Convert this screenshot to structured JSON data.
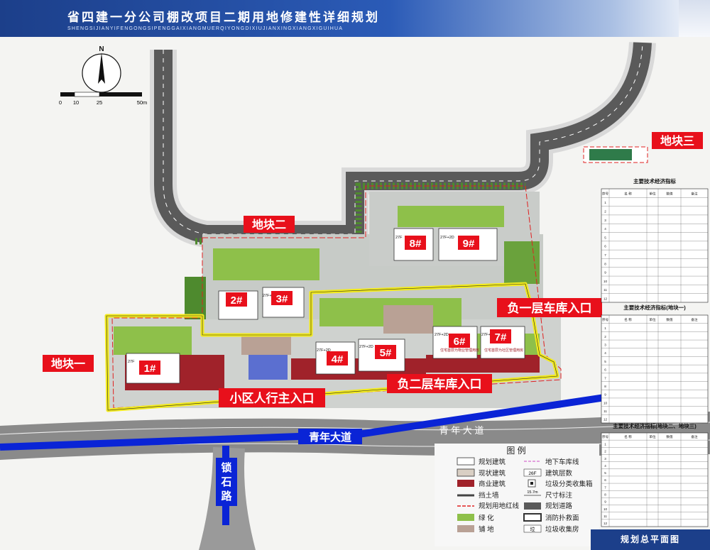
{
  "header": {
    "title": "省四建一分公司棚改项目二期用地修建性详细规划",
    "pinyin": "SHENGSIJIANYIFENGONGSIPENGGAIXIANGMUERQIYONGDIXIUJIANXINGXIANGXIGUIHUA"
  },
  "footer": {
    "label": "规划总平面图"
  },
  "compass": {
    "north": "N",
    "scale_ticks": [
      "0",
      "10",
      "25",
      "50m"
    ]
  },
  "plots": {
    "plot1": "地块一",
    "plot2": "地块二",
    "plot3": "地块三"
  },
  "entrances": {
    "ped_main": "小区人行主入口",
    "garage_b1": "负一层车库入口",
    "garage_b2": "负二层车库入口"
  },
  "roads": {
    "qingnian": "青年大道",
    "qingnian_spaced": "青 年 大 道",
    "suoshi": "锁石路"
  },
  "buildings": [
    {
      "id": "1#",
      "floors": "27F"
    },
    {
      "id": "2#",
      "floors": "27F"
    },
    {
      "id": "3#",
      "floors": "27F+2D"
    },
    {
      "id": "4#",
      "floors": "27F+2D"
    },
    {
      "id": "5#",
      "floors": "27F+2D"
    },
    {
      "id": "6#",
      "floors": "27F+2D"
    },
    {
      "id": "7#",
      "floors": "27F+2D"
    },
    {
      "id": "8#",
      "floors": "27F"
    },
    {
      "id": "9#",
      "floors": "27F+2D"
    }
  ],
  "notes": {
    "mgmt1": "住宅首层为物业管理用房",
    "mgmt2": "住宅首层为社区管理用房"
  },
  "legend": {
    "title": "图 例",
    "items": [
      {
        "label": "规划建筑",
        "swatch": "#ffffff"
      },
      {
        "label": "现状建筑",
        "swatch": "#d9cfc4"
      },
      {
        "label": "商业建筑",
        "swatch": "#a0222a"
      },
      {
        "label": "挡土墙",
        "swatch": "#444444"
      },
      {
        "label": "规划用地红线",
        "swatch": "#e02020"
      },
      {
        "label": "绿  化",
        "swatch": "#8ec04a"
      },
      {
        "label": "铺  地",
        "swatch": "#b9a195"
      },
      {
        "label": "地下车库线",
        "swatch": "#d66bd0"
      },
      {
        "label": "建筑层数",
        "swatch": "26F"
      },
      {
        "label": "垃圾分类收集箱",
        "swatch": "#222222"
      },
      {
        "label": "尺寸标注",
        "swatch": "15.7m"
      },
      {
        "label": "规划道路",
        "swatch": "#5a5a5a"
      },
      {
        "label": "消防扑救面",
        "swatch": "#333333"
      },
      {
        "label": "垃圾收集房",
        "swatch": "垃"
      }
    ]
  },
  "tables": {
    "t1": {
      "title": "主要技术经济指标",
      "header": [
        "序号",
        "名  称",
        "单位",
        "数值",
        "备注"
      ],
      "rows": [
        "1",
        "2",
        "3",
        "4",
        "5",
        "6",
        "7",
        "8",
        "9",
        "10",
        "11",
        "12"
      ]
    },
    "t2": {
      "title": "主要技术经济指标(地块一)",
      "header": [
        "序号",
        "名  称",
        "单位",
        "数值",
        "备注"
      ],
      "rows": [
        "1",
        "2",
        "3",
        "4",
        "5",
        "6",
        "7",
        "8",
        "9",
        "10",
        "11",
        "12"
      ]
    },
    "t3": {
      "title": "主要技术经济指标(地块二、地块三)",
      "header": [
        "序号",
        "名  称",
        "单位",
        "数值",
        "备注"
      ],
      "rows": [
        "1",
        "2",
        "3",
        "4",
        "5",
        "6",
        "7",
        "8",
        "9",
        "10",
        "11",
        "12"
      ]
    }
  },
  "colors": {
    "header_blue": "#1c3f8a",
    "label_red": "#e8101b",
    "site_yellow": "#f2ea1e",
    "road_blue": "#0a24d6",
    "road_grey": "#8a8a8a",
    "green": "#7fb24a"
  }
}
